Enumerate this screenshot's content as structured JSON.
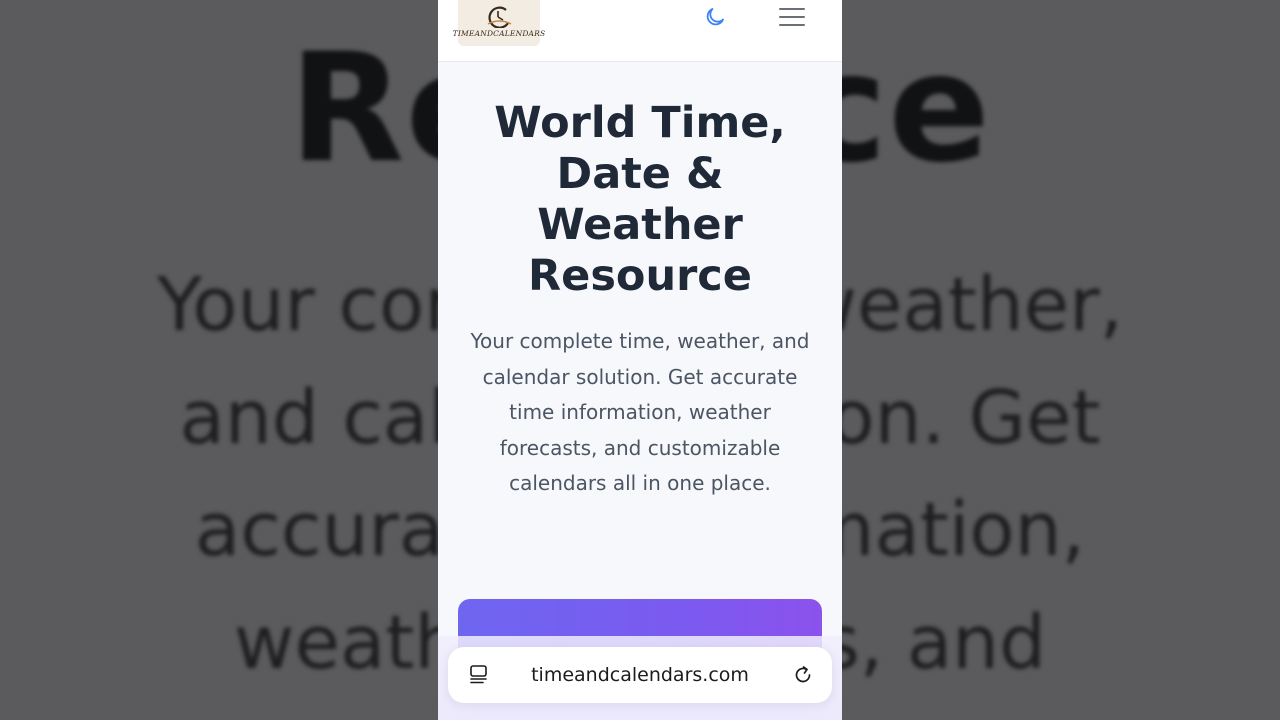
{
  "background": {
    "title_fragment_left": "Re",
    "title_fragment_right": "ce",
    "line1_left": "Your com",
    "line1_right": "weather,",
    "line2_left": "and cal",
    "line2_right": "ion. Get",
    "line3_left": "accurat",
    "line3_right": "rmation,",
    "line4_left": "weath",
    "line4_right": "s, and"
  },
  "header": {
    "logo_text": "TIMEANDCALENDARS",
    "moon_icon": "moon-icon",
    "menu_icon": "hamburger-menu-icon"
  },
  "hero": {
    "title": "World Time, Date & Weather Resource",
    "subtitle": "Your complete time, weather, and calendar solution. Get accurate time information, weather forecasts, and customizable calendars all in one place."
  },
  "browser": {
    "url": "timeandcalendars.com",
    "tabs_icon": "tabs-icon",
    "reload_icon": "reload-icon"
  },
  "colors": {
    "title": "#1f2937",
    "subtitle": "#4b5563",
    "accent_moon": "#3b82f6",
    "cta_start": "#6f66f0",
    "cta_end": "#8b52ec"
  }
}
